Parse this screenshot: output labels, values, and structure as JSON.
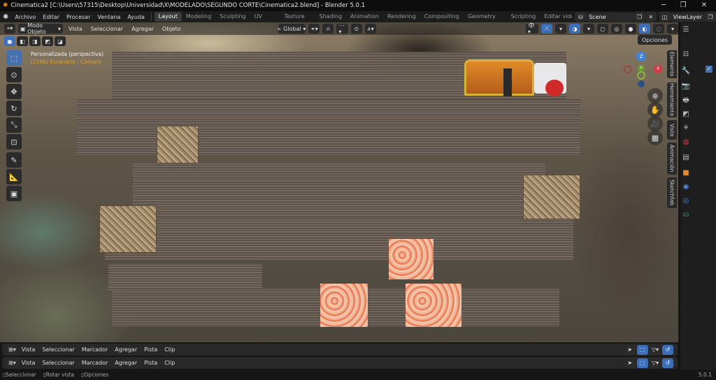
{
  "window": {
    "title": "Cinematica2 [C:\\Users\\57315\\Desktop\\Universidad\\X\\MODELADO\\SEGUNDO CORTE\\Cinematica2.blend] - Blender 5.0.1",
    "minimize": "─",
    "maximize": "❐",
    "close": "✕"
  },
  "menu": [
    "Archivo",
    "Editar",
    "Procesar",
    "Ventana",
    "Ayuda"
  ],
  "workspaces": [
    "Layout",
    "Modeling",
    "Sculpting",
    "UV Editing",
    "Texture Paint",
    "Shading",
    "Animation",
    "Rendering",
    "Compositing",
    "Geometry Nodes",
    "Scripting",
    "Editar video"
  ],
  "active_workspace": "Layout",
  "scene": "Scene",
  "view_layer": "ViewLayer",
  "viewport": {
    "mode": "Modo Objeto",
    "menus": [
      "Vista",
      "Seleccionar",
      "Agregar",
      "Objeto"
    ],
    "orientation": "Global",
    "options": "Opciones",
    "view_name": "Personalizada (perspectiva)",
    "context": "[2166] Escenario | Cámara",
    "side_tabs": [
      "Elemento",
      "Herramienta",
      "Vista",
      "Animación",
      "Sketchfab"
    ],
    "gizmo": {
      "z": "Z",
      "y": "Y",
      "x": "X"
    }
  },
  "timeline": {
    "menus": [
      "Vista",
      "Seleccionar",
      "Marcador",
      "Agregar",
      "Pista",
      "Clip"
    ]
  },
  "status": {
    "items": [
      "Seleccionar",
      "Rotar vista",
      "Opciones"
    ],
    "version": "5.0.1"
  },
  "colors": {
    "accent": "#4670ad",
    "orange": "#f08a24"
  }
}
